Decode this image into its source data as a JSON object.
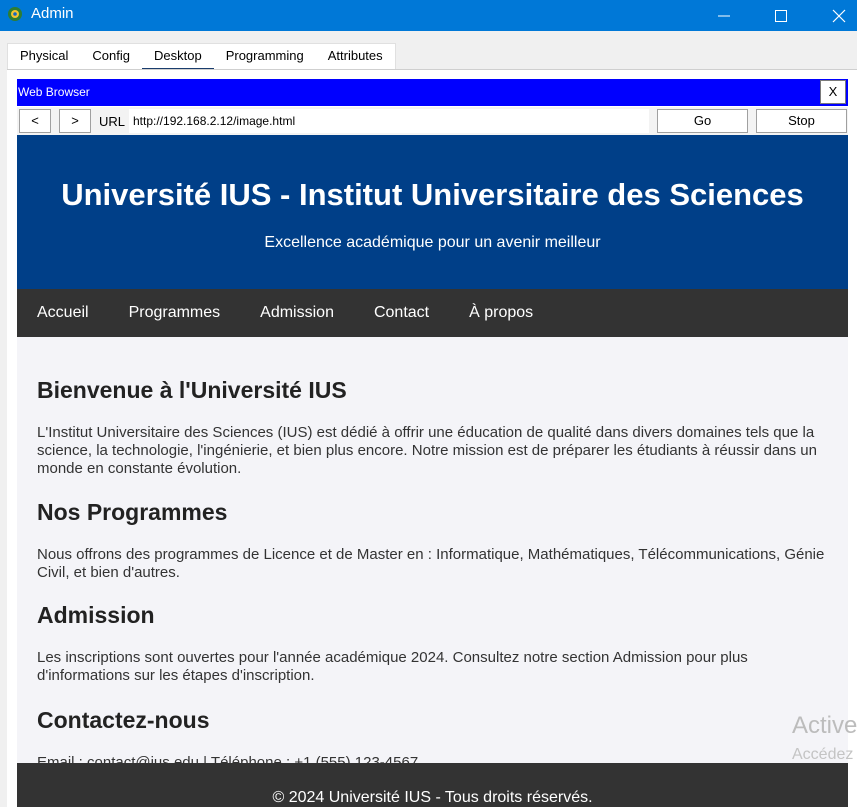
{
  "window": {
    "title": "Admin",
    "accent_color": "#0078d7"
  },
  "tabs": [
    {
      "label": "Physical"
    },
    {
      "label": "Config"
    },
    {
      "label": "Desktop",
      "active": true
    },
    {
      "label": "Programming"
    },
    {
      "label": "Attributes"
    }
  ],
  "browser": {
    "title": "Web Browser",
    "close_label": "X",
    "back_label": "<",
    "forward_label": ">",
    "url_label": "URL",
    "url": "http://192.168.2.12/image.html",
    "go_label": "Go",
    "stop_label": "Stop",
    "header_color": "#0000ff"
  },
  "page": {
    "hero_title": "Université IUS - Institut Universitaire des Sciences",
    "hero_subtitle": "Excellence académique pour un avenir meilleur",
    "hero_color": "#003f88",
    "nav": [
      "Accueil",
      "Programmes",
      "Admission",
      "Contact",
      "À propos"
    ],
    "sections": [
      {
        "heading": "Bienvenue à l'Université IUS",
        "text": "L'Institut Universitaire des Sciences (IUS) est dédié à offrir une éducation de qualité dans divers domaines tels que la science, la technologie, l'ingénierie, et bien plus encore. Notre mission est de préparer les étudiants à réussir dans un monde en constante évolution."
      },
      {
        "heading": "Nos Programmes",
        "text": "Nous offrons des programmes de Licence et de Master en : Informatique, Mathématiques, Télécommunications, Génie Civil, et bien d'autres."
      },
      {
        "heading": "Admission",
        "text": "Les inscriptions sont ouvertes pour l'année académique 2024. Consultez notre section Admission pour plus d'informations sur les étapes d'inscription."
      },
      {
        "heading": "Contactez-nous",
        "text": "Email : contact@ius.edu | Téléphone : +1 (555) 123-4567"
      }
    ],
    "footer": "© 2024 Université IUS - Tous droits réservés."
  },
  "overlay": {
    "watermark_line1": "Active",
    "watermark_line2": "Accédez"
  }
}
